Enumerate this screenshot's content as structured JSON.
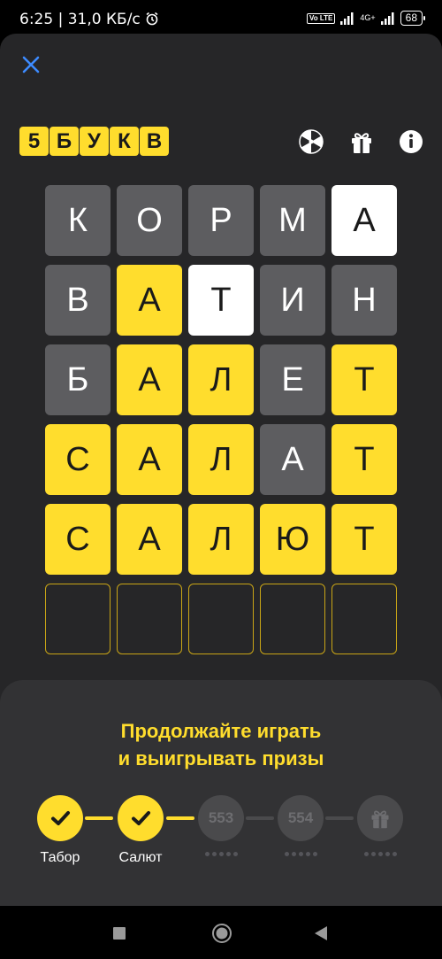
{
  "status_bar": {
    "time_speed": "6:25 | 31,0 КБ/с",
    "volte": "Vo LTE",
    "network": "4G+",
    "battery": "68"
  },
  "header": {
    "logo_letters": [
      "5",
      "Б",
      "У",
      "К",
      "В"
    ],
    "icons": [
      "close-icon",
      "wheel-icon",
      "gift-icon",
      "info-icon"
    ]
  },
  "board": {
    "rows": [
      [
        {
          "l": "К",
          "s": "gray"
        },
        {
          "l": "О",
          "s": "gray"
        },
        {
          "l": "Р",
          "s": "gray"
        },
        {
          "l": "М",
          "s": "gray"
        },
        {
          "l": "А",
          "s": "white"
        }
      ],
      [
        {
          "l": "В",
          "s": "gray"
        },
        {
          "l": "А",
          "s": "yellow"
        },
        {
          "l": "Т",
          "s": "white"
        },
        {
          "l": "И",
          "s": "gray"
        },
        {
          "l": "Н",
          "s": "gray"
        }
      ],
      [
        {
          "l": "Б",
          "s": "gray"
        },
        {
          "l": "А",
          "s": "yellow"
        },
        {
          "l": "Л",
          "s": "yellow"
        },
        {
          "l": "Е",
          "s": "gray"
        },
        {
          "l": "Т",
          "s": "yellow"
        }
      ],
      [
        {
          "l": "С",
          "s": "yellow"
        },
        {
          "l": "А",
          "s": "yellow"
        },
        {
          "l": "Л",
          "s": "yellow"
        },
        {
          "l": "А",
          "s": "gray"
        },
        {
          "l": "Т",
          "s": "yellow"
        }
      ],
      [
        {
          "l": "С",
          "s": "yellow"
        },
        {
          "l": "А",
          "s": "yellow"
        },
        {
          "l": "Л",
          "s": "yellow"
        },
        {
          "l": "Ю",
          "s": "yellow"
        },
        {
          "l": "Т",
          "s": "yellow"
        }
      ],
      [
        {
          "l": "",
          "s": "empty"
        },
        {
          "l": "",
          "s": "empty"
        },
        {
          "l": "",
          "s": "empty"
        },
        {
          "l": "",
          "s": "empty"
        },
        {
          "l": "",
          "s": "empty"
        }
      ]
    ]
  },
  "sheet": {
    "title_line1": "Продолжайте играть",
    "title_line2": "и выигрывать призы",
    "steps": [
      {
        "state": "done",
        "label": "Табор"
      },
      {
        "state": "done",
        "label": "Салют"
      },
      {
        "state": "future",
        "number": "553"
      },
      {
        "state": "future",
        "number": "554"
      },
      {
        "state": "gift"
      }
    ]
  },
  "colors": {
    "accent_yellow": "#ffdd2d",
    "tile_gray": "#5d5d60",
    "background": "#262628",
    "sheet": "#323234"
  },
  "nav": [
    "recent-apps-icon",
    "home-icon",
    "back-icon"
  ]
}
